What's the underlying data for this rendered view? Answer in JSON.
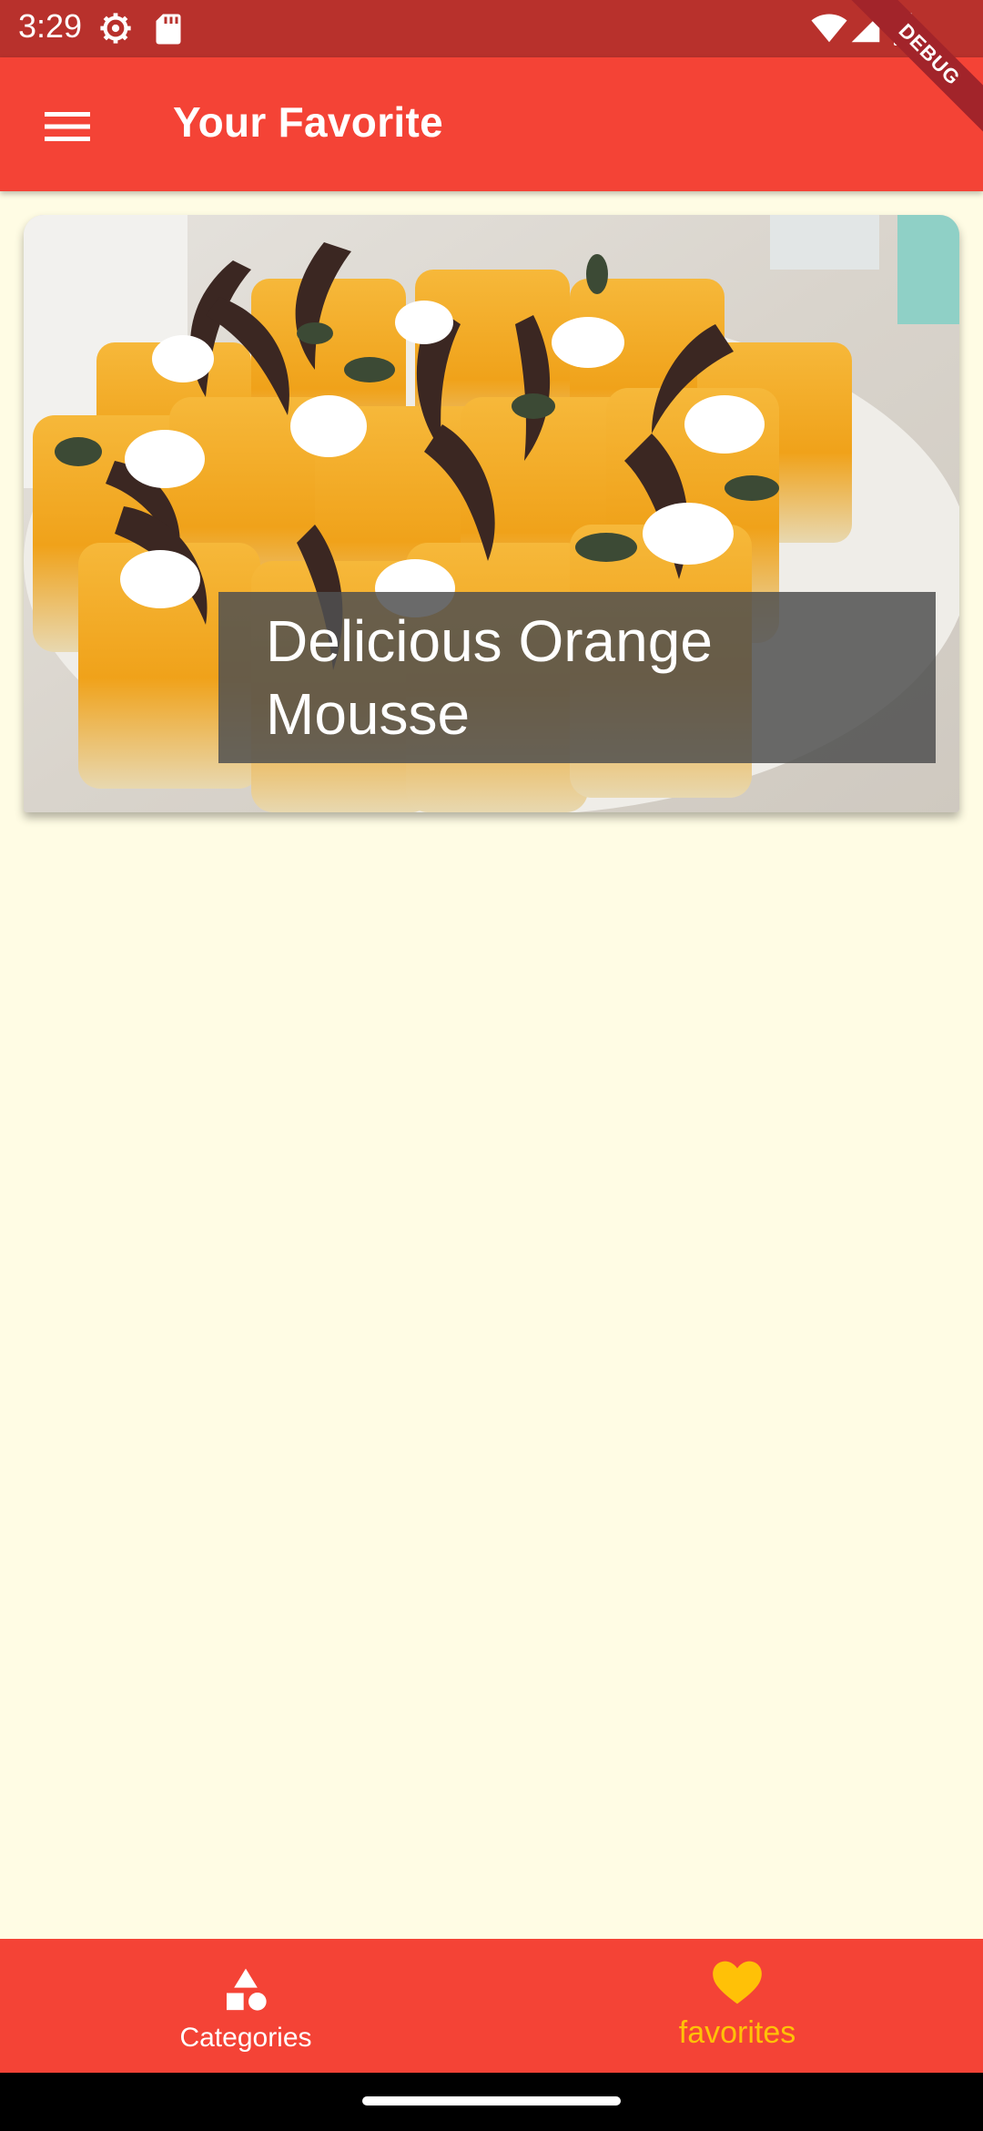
{
  "status_bar": {
    "time": "3:29",
    "icons": [
      "settings-icon",
      "sd-card-icon",
      "wifi-icon",
      "signal-icon",
      "battery-icon"
    ]
  },
  "app_bar": {
    "title": "Your Favorite",
    "menu_icon": "hamburger-menu-icon",
    "background_color": "#F44336"
  },
  "debug_banner": "DEBUG",
  "favorites": [
    {
      "title": "Delicious Orange Mousse",
      "image": "orange-mousse-cups-photo"
    }
  ],
  "bottom_nav": {
    "items": [
      {
        "label": "Categories",
        "icon": "categories-shapes-icon",
        "selected": false
      },
      {
        "label": "favorites",
        "icon": "heart-icon",
        "selected": true
      }
    ],
    "selected_color": "#FFC107",
    "unselected_color": "#FFFFFF"
  },
  "colors": {
    "primary": "#F44336",
    "status_bar": "#B8312C",
    "background": "#FFFCE4",
    "accent": "#FFC107"
  }
}
